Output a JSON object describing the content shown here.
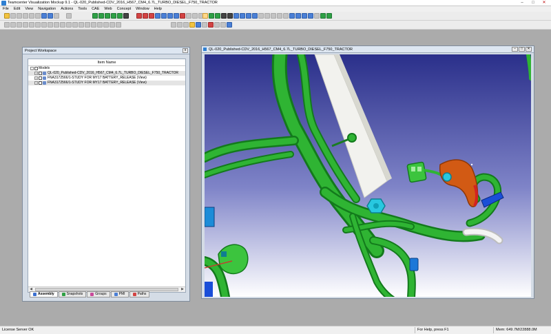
{
  "window": {
    "title": "Teamcenter Visualization Mockup 9.1 - QL-020_Published-CDV_2016_H567_CM4_6.7L_TURBO_DIESEL_F750_TRACTOR",
    "minimize": "–",
    "maximize": "□",
    "close": "✕"
  },
  "menu": [
    "File",
    "Edit",
    "View",
    "Navigation",
    "Actions",
    "Tools",
    "CAE",
    "Web",
    "Concept",
    "Window",
    "Help"
  ],
  "project_workspace": {
    "title": "Project Workspace",
    "close": "x",
    "column_header": "Item Name",
    "tree": [
      {
        "label": "Models",
        "level": 0
      },
      {
        "label": "QL-020_Published-CDV_2016_H567_CM4_6.7L_TURBO_DIESEL_F750_TRACTOR",
        "level": 1
      },
      {
        "label": "FNA3172566/1-STUDY FOR MY17 BATTERY_RELEASE (View)",
        "level": 1
      },
      {
        "label": "FNA3172566/1-STUDY FOR MY17 BATTERY_RELEASE (View)",
        "level": 1
      }
    ],
    "tabs": [
      {
        "label": "Assembly",
        "color": "#3a6fd0"
      },
      {
        "label": "Snapshots",
        "color": "#2ea045"
      },
      {
        "label": "Groups",
        "color": "#c84a9a"
      },
      {
        "label": "PMI",
        "color": "#4a7fd6"
      },
      {
        "label": "Paths",
        "color": "#d24343"
      }
    ],
    "scroll_left": "◀",
    "scroll_right": "▶"
  },
  "viewer_window": {
    "title": "QL-020_Published-CDV_2016_H567_CM4_6.7L_TURBO_DIESEL_F750_TRACTOR",
    "buttons": [
      "–",
      "□",
      "✕"
    ]
  },
  "status": {
    "left": "License Server OK",
    "middle": "For Help, press F1",
    "right": "Mem: 649.7M/22888.0M"
  },
  "colors": {
    "harness_green": "#22a02a",
    "viewport_top": "#2a2f8a",
    "viewport_bottom": "#ffffff",
    "bracket_white": "#f2f2ee",
    "connector_orange": "#d25a14",
    "connector_cyan": "#28c8e0"
  }
}
